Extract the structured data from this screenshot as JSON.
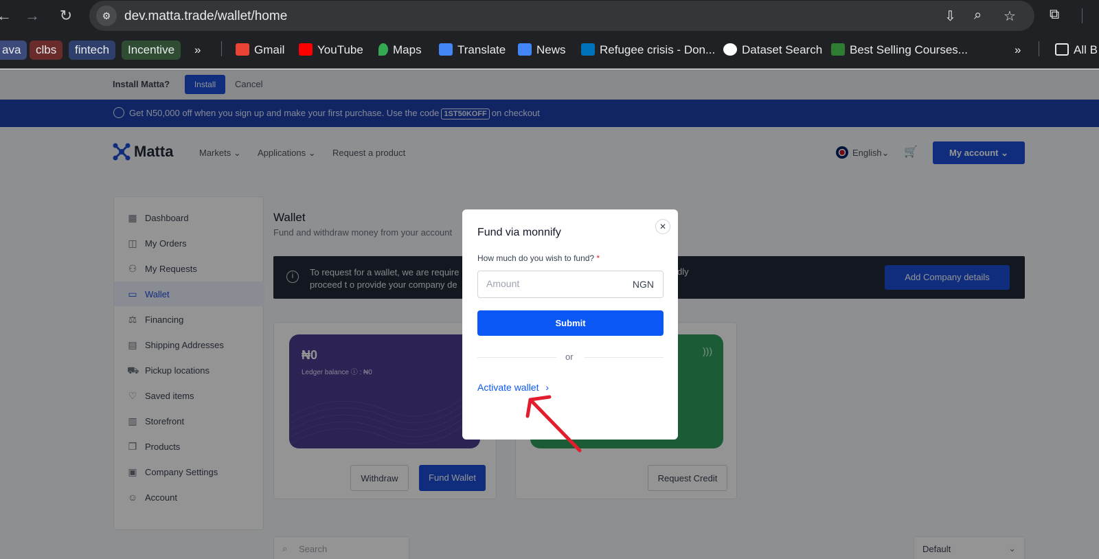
{
  "browser": {
    "url": "dev.matta.trade/wallet/home",
    "bookmarks": [
      {
        "label": "ava",
        "color": "#3b4a7a"
      },
      {
        "label": "clbs",
        "color": "#7a2e2e"
      },
      {
        "label": "fintech",
        "color": "#2e3f6b"
      },
      {
        "label": "Incentive",
        "color": "#2f4d33"
      }
    ],
    "links": [
      {
        "label": "Gmail",
        "icon": "gmail-icon",
        "color": "#ea4335"
      },
      {
        "label": "YouTube",
        "icon": "youtube-icon",
        "color": "#ff0000"
      },
      {
        "label": "Maps",
        "icon": "maps-icon",
        "color": "#34a853"
      },
      {
        "label": "Translate",
        "icon": "translate-icon",
        "color": "#4285f4"
      },
      {
        "label": "News",
        "icon": "news-icon",
        "color": "#4285f4"
      },
      {
        "label": "Refugee crisis - Don...",
        "icon": "unhcr-icon",
        "color": "#0072bc"
      },
      {
        "label": "Dataset Search",
        "icon": "google-icon",
        "color": "#ffffff"
      },
      {
        "label": "Best Selling Courses...",
        "icon": "courses-icon",
        "color": "#2e7d32"
      }
    ],
    "all_bookmarks": "All B"
  },
  "install_bar": {
    "question": "Install Matta?",
    "install": "Install",
    "cancel": "Cancel"
  },
  "promo": {
    "text_before": "Get N50,000 off when you sign up and make your first purchase.  Use the code",
    "code": "1ST50KOFF",
    "text_after": "on checkout"
  },
  "header": {
    "logo": "Matta",
    "nav": [
      "Markets",
      "Applications",
      "Request a product"
    ],
    "language": "English",
    "account": "My account"
  },
  "sidebar": {
    "items": [
      {
        "label": "Dashboard",
        "icon": "dashboard-icon"
      },
      {
        "label": "My Orders",
        "icon": "orders-icon"
      },
      {
        "label": "My Requests",
        "icon": "requests-icon"
      },
      {
        "label": "Wallet",
        "icon": "wallet-icon"
      },
      {
        "label": "Financing",
        "icon": "financing-icon"
      },
      {
        "label": "Shipping Addresses",
        "icon": "map-icon"
      },
      {
        "label": "Pickup locations",
        "icon": "truck-icon"
      },
      {
        "label": "Saved items",
        "icon": "heart-icon"
      },
      {
        "label": "Storefront",
        "icon": "storefront-icon"
      },
      {
        "label": "Products",
        "icon": "products-icon"
      },
      {
        "label": "Company Settings",
        "icon": "building-icon"
      },
      {
        "label": "Account",
        "icon": "user-icon"
      }
    ],
    "active": "Wallet"
  },
  "main": {
    "title": "Wallet",
    "subtitle": "Fund and withdraw money from your account",
    "alert_line1": "To request for a wallet, we are require",
    "alert_line1_end": "dly",
    "alert_line2": "proceed t o provide your company de",
    "add_company": "Add Company details",
    "wallet_card": {
      "amount": "₦0",
      "ledger": "Ledger balance ⓘ : ₦0"
    },
    "withdraw": "Withdraw",
    "fund_wallet": "Fund Wallet",
    "request_credit": "Request Credit",
    "search_placeholder": "Search",
    "sort": "Default"
  },
  "modal": {
    "title": "Fund via monnify",
    "label": "How much do you wish to fund?",
    "required_mark": "*",
    "amount_placeholder": "Amount",
    "currency": "NGN",
    "submit": "Submit",
    "or": "or",
    "activate": "Activate wallet"
  },
  "colors": {
    "brand": "#1d4ed8",
    "modal_primary": "#0b57f5",
    "wallet_card": "#4c3b8f",
    "credit_card": "#2f9e5c",
    "annotation_arrow": "#e11d2e"
  }
}
